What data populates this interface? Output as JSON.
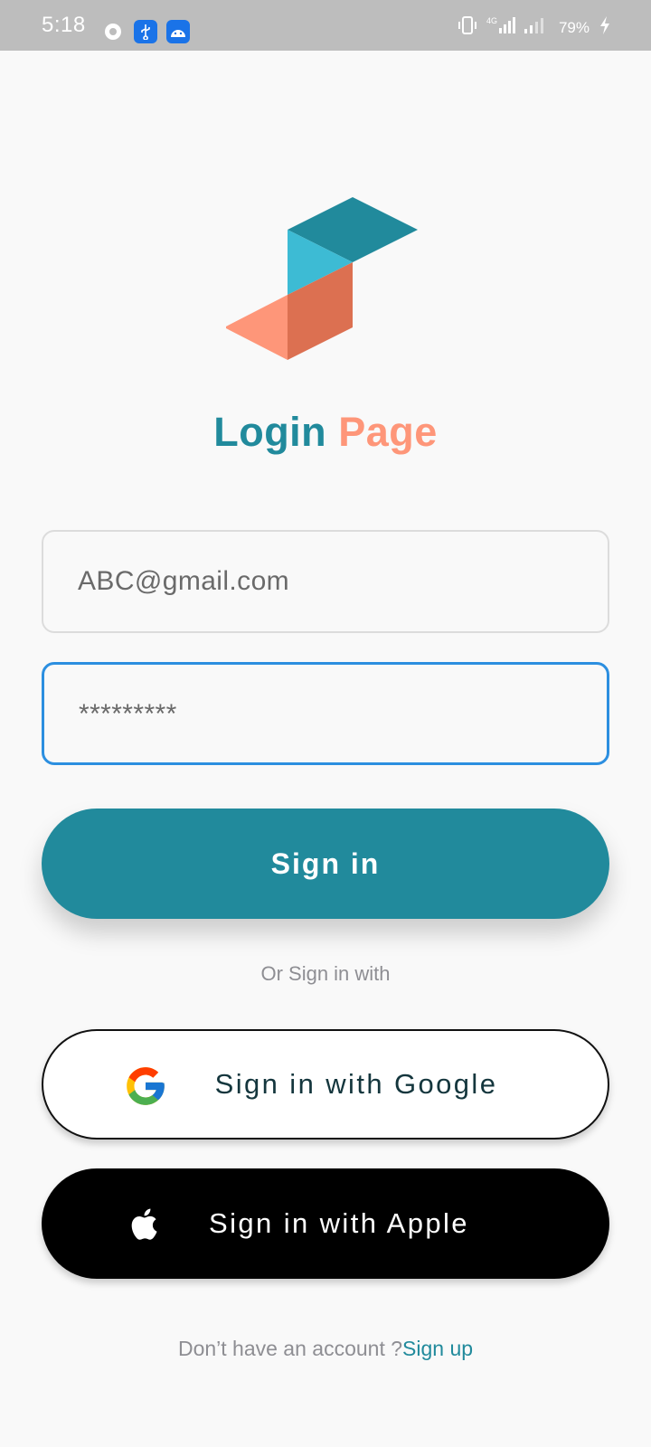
{
  "status_bar": {
    "time": "5:18",
    "battery": "79%",
    "network": "4G",
    "icons": [
      "settings-notification-icon",
      "usb-icon",
      "android-icon",
      "vibrate-icon",
      "signal-icon",
      "battery-charging-icon"
    ]
  },
  "login": {
    "title_part1": "Login",
    "title_part2": "Page",
    "email_value": "ABC@gmail.com",
    "password_value": "*********",
    "signin_label": "Sign in",
    "or_text": "Or Sign in with",
    "google_label": "Sign in with Google",
    "apple_label": "Sign in with Apple",
    "footer_text": "Don’t have an account ?",
    "footer_link": "Sign up"
  },
  "colors": {
    "primary": "#218a9c",
    "accent": "#fe9679",
    "focus_border": "#2c8fe0",
    "background": "#f9f9f9"
  }
}
